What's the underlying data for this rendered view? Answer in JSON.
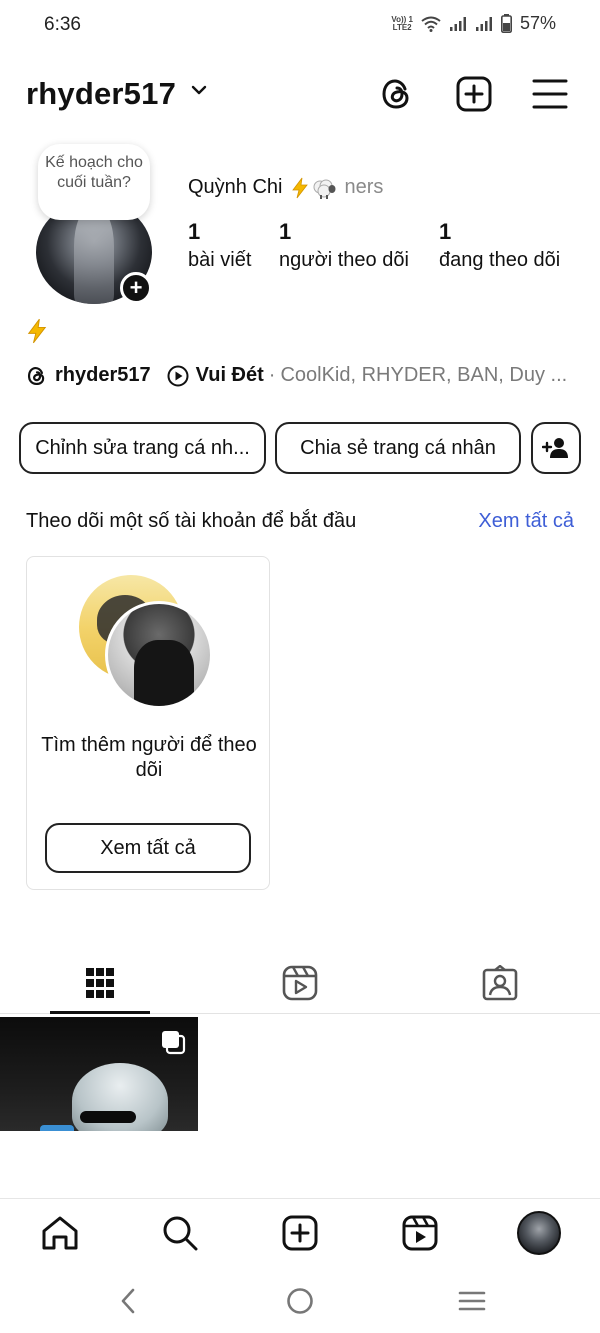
{
  "status_bar": {
    "time": "6:36",
    "volte_top": "Vo)) 1",
    "volte_bottom": "LTE2",
    "battery_percent": "57%"
  },
  "header": {
    "username": "rhyder517",
    "icons": [
      "threads-icon",
      "create-post-icon",
      "menu-icon"
    ]
  },
  "profile": {
    "note": "Kế hoạch cho cuối tuần?",
    "display_name": "Quỳnh Chi",
    "display_suffix": "ners",
    "stats": [
      {
        "count": "1",
        "label": "bài viết"
      },
      {
        "count": "1",
        "label": "người theo dõi"
      },
      {
        "count": "1",
        "label": "đang theo dõi"
      }
    ],
    "bio": "⚡",
    "threads_handle": "rhyder517",
    "music_title": "Vui Đét",
    "music_artists": "CoolKid, RHYDER, BAN, Duy ..."
  },
  "actions": {
    "edit_profile": "Chỉnh sửa trang cá nh...",
    "share_profile": "Chia sẻ trang cá nhân"
  },
  "suggestions": {
    "title": "Theo dõi một số tài khoản để bắt đầu",
    "see_all": "Xem tất cả",
    "card_text": "Tìm thêm người để theo dõi",
    "card_button": "Xem tất cả"
  },
  "tabs": [
    "grid-icon",
    "reels-icon",
    "tagged-icon"
  ],
  "bottom_nav": [
    "home-icon",
    "search-icon",
    "create-icon",
    "reels-icon",
    "profile-avatar"
  ],
  "colors": {
    "accent_link": "#3e5ed6",
    "text": "#111111",
    "muted": "#7a7a7a"
  }
}
